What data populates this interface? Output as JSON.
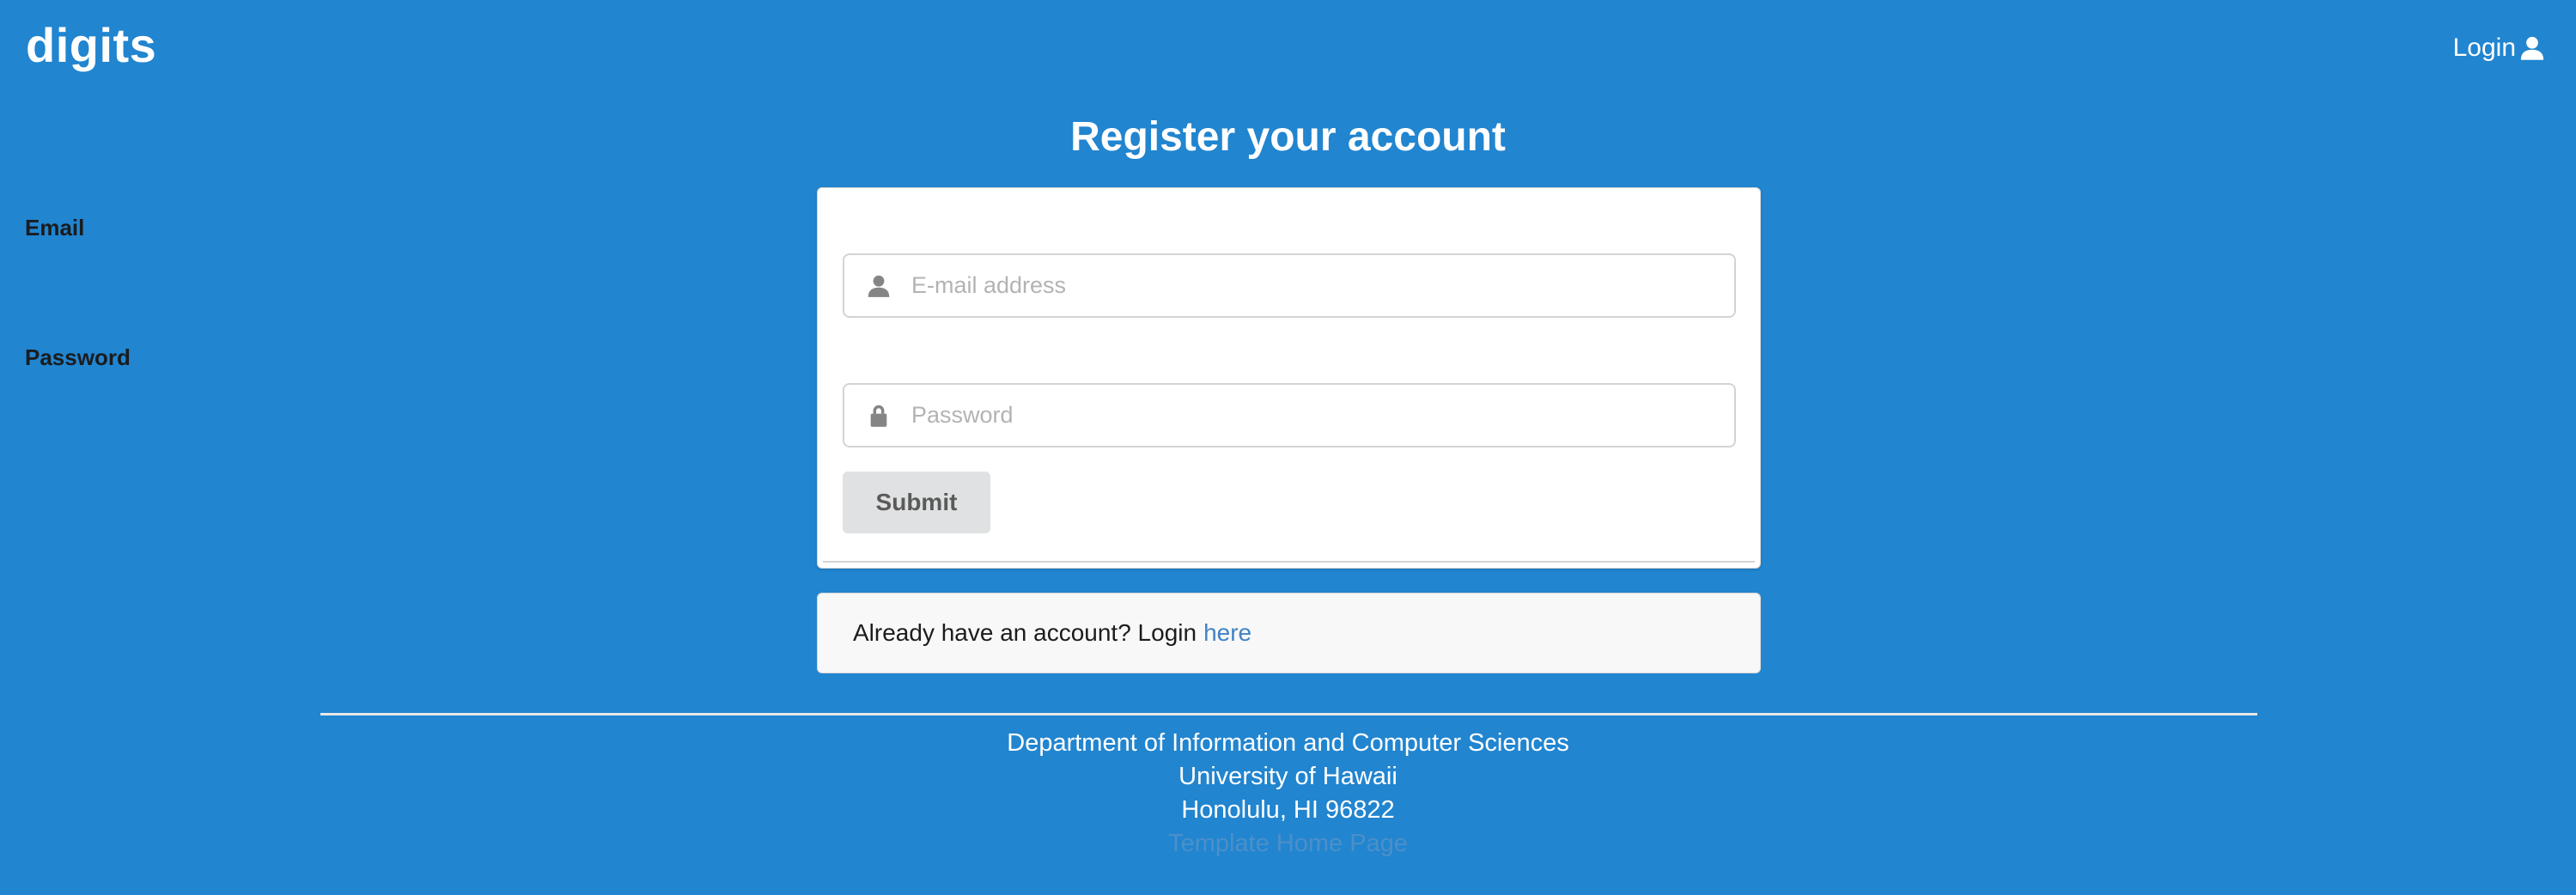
{
  "header": {
    "brand": "digits",
    "login_label": "Login",
    "login_icon": "user-icon"
  },
  "main": {
    "title": "Register your account",
    "form": {
      "email_label": "Email",
      "email_placeholder": "E-mail address",
      "email_icon": "user-icon",
      "password_label": "Password",
      "password_placeholder": "Password",
      "password_icon": "lock-icon",
      "submit_label": "Submit"
    },
    "login_prompt": {
      "text": "Already have an account? Login",
      "link_label": "here"
    }
  },
  "footer": {
    "line1": "Department of Information and Computer Sciences",
    "line2": "University of Hawaii",
    "line3": "Honolulu, HI 96822",
    "link_label": "Template Home Page"
  },
  "colors": {
    "background": "#2185d0",
    "card": "#ffffff",
    "link": "#4183c4",
    "button": "#e0e1e2"
  }
}
